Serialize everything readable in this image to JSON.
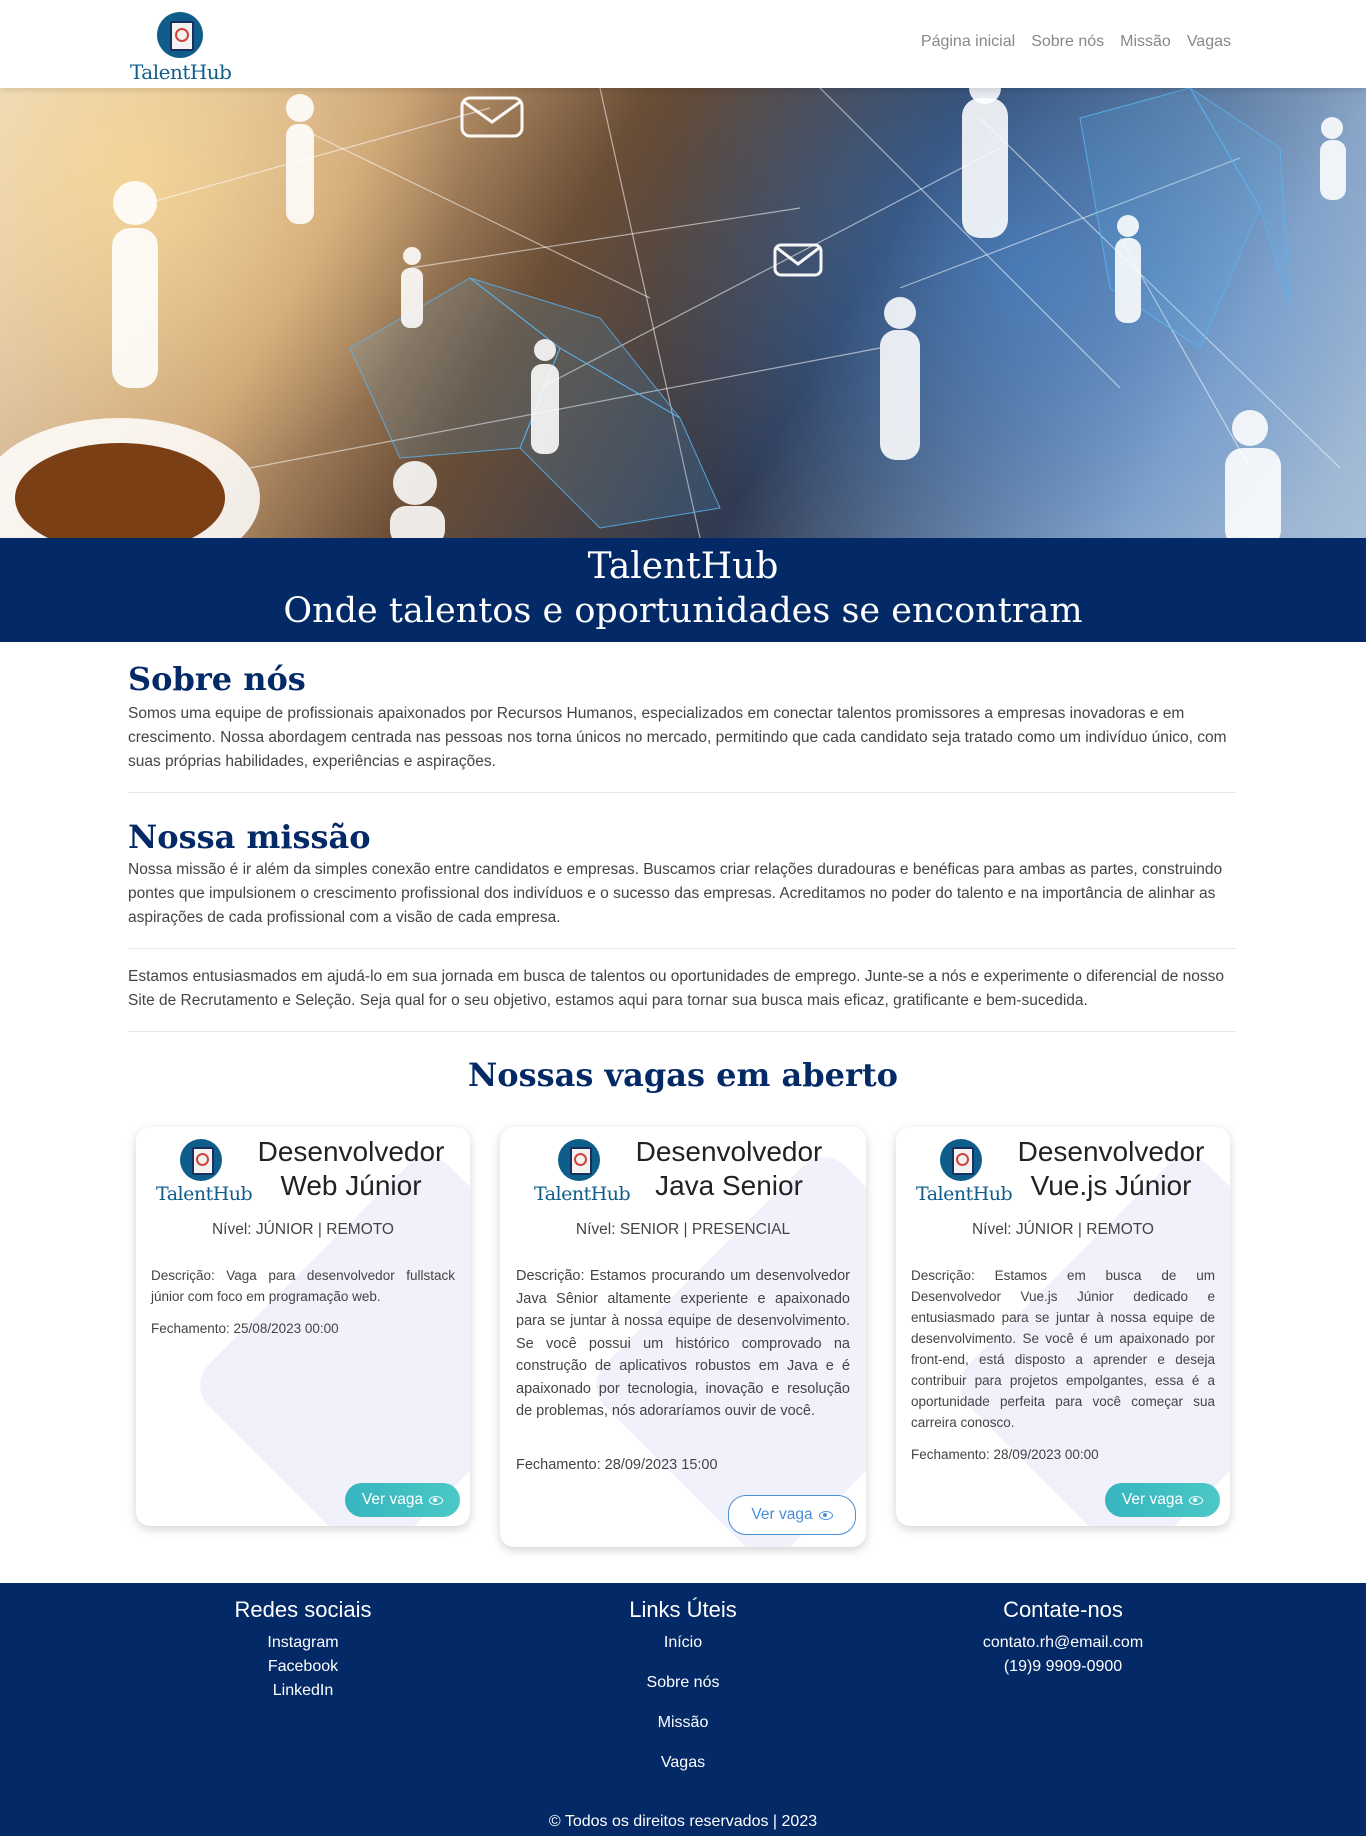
{
  "brand": {
    "name": "TalentHub"
  },
  "nav": {
    "items": [
      "Página inicial",
      "Sobre nós",
      "Missão",
      "Vagas"
    ]
  },
  "hero": {
    "title": "TalentHub",
    "subtitle": "Onde talentos e oportunidades se encontram"
  },
  "about": {
    "title": "Sobre nós",
    "text": "Somos uma equipe de profissionais apaixonados por Recursos Humanos, especializados em conectar talentos promissores a empresas inovadoras e em crescimento. Nossa abordagem centrada nas pessoas nos torna únicos no mercado, permitindo que cada candidato seja tratado como um indivíduo único, com suas próprias habilidades, experiências e aspirações."
  },
  "mission": {
    "title": "Nossa missão",
    "text": "Nossa missão é ir além da simples conexão entre candidatos e empresas. Buscamos criar relações duradouras e benéficas para ambas as partes, construindo pontes que impulsionem o crescimento profissional dos indivíduos e o sucesso das empresas. Acreditamos no poder do talento e na importância de alinhar as aspirações de cada profissional com a visão de cada empresa.",
    "text2": "Estamos entusiasmados em ajudá-lo em sua jornada em busca de talentos ou oportunidades de emprego. Junte-se a nós e experimente o diferencial de nosso Site de Recrutamento e Seleção. Seja qual for o seu objetivo, estamos aqui para tornar sua busca mais eficaz, gratificante e bem-sucedida."
  },
  "jobs": {
    "title": "Nossas vagas em aberto",
    "button_label": "Ver vaga",
    "items": [
      {
        "title": "Desenvolvedor Web Júnior",
        "level": "Nível: JÚNIOR | REMOTO",
        "description": "Descrição: Vaga para desenvolvedor fullstack júnior com foco em programação web.",
        "closing": "Fechamento: 25/08/2023 00:00"
      },
      {
        "title": "Desenvolvedor Java Senior",
        "level": "Nível: SENIOR | PRESENCIAL",
        "description": "Descrição: Estamos procurando um desenvolvedor Java Sênior altamente experiente e apaixonado para se juntar à nossa equipe de desenvolvimento. Se você possui um histórico comprovado na construção de aplicativos robustos em Java e é apaixonado por tecnologia, inovação e resolução de problemas, nós adoraríamos ouvir de você.",
        "closing": "Fechamento: 28/09/2023 15:00"
      },
      {
        "title": "Desenvolvedor Vue.js Júnior",
        "level": "Nível: JÚNIOR | REMOTO",
        "description": "Descrição: Estamos em busca de um Desenvolvedor Vue.js Júnior dedicado e entusiasmado para se juntar à nossa equipe de desenvolvimento. Se você é um apaixonado por front-end, está disposto a aprender e deseja contribuir para projetos empolgantes, essa é a oportunidade perfeita para você começar sua carreira conosco.",
        "closing": "Fechamento: 28/09/2023 00:00"
      }
    ]
  },
  "footer": {
    "social": {
      "title": "Redes sociais",
      "items": [
        "Instagram",
        "Facebook",
        "LinkedIn"
      ]
    },
    "links": {
      "title": "Links Úteis",
      "items": [
        "Início",
        "Sobre nós",
        "Missão",
        "Vagas"
      ]
    },
    "contact": {
      "title": "Contate-nos",
      "email": "contato.rh@email.com",
      "phone": "(19)9 9909-0900"
    },
    "copyright": "© Todos os direitos reservados | 2023"
  },
  "colors": {
    "primary": "#032a66",
    "accent": "#37b5bf",
    "link_outline": "#4a8fd6"
  }
}
